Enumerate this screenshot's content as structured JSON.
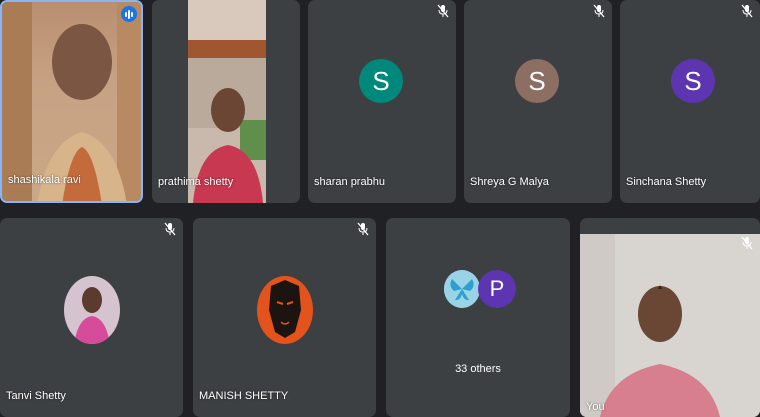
{
  "participants": [
    {
      "name": "shashikala ravi"
    },
    {
      "name": "prathima shetty"
    },
    {
      "name": "sharan prabhu",
      "initial": "S",
      "color": "#00897b"
    },
    {
      "name": "Shreya G Malya",
      "initial": "S",
      "color": "#8d6e63"
    },
    {
      "name": "Sinchana Shetty",
      "initial": "S",
      "color": "#5e35b1"
    },
    {
      "name": "Tanvi Shetty"
    },
    {
      "name": "MANISH SHETTY"
    },
    {
      "name": "You"
    }
  ],
  "others": {
    "initial": "P",
    "color": "#5e35b1",
    "label": "33 others"
  },
  "icons": {
    "muted": "mic-off-icon",
    "speaking": "speaking-indicator-icon"
  },
  "colors": {
    "active_border": "#8ab4f8",
    "tile_bg": "#3c4043",
    "page_bg": "#202124"
  }
}
